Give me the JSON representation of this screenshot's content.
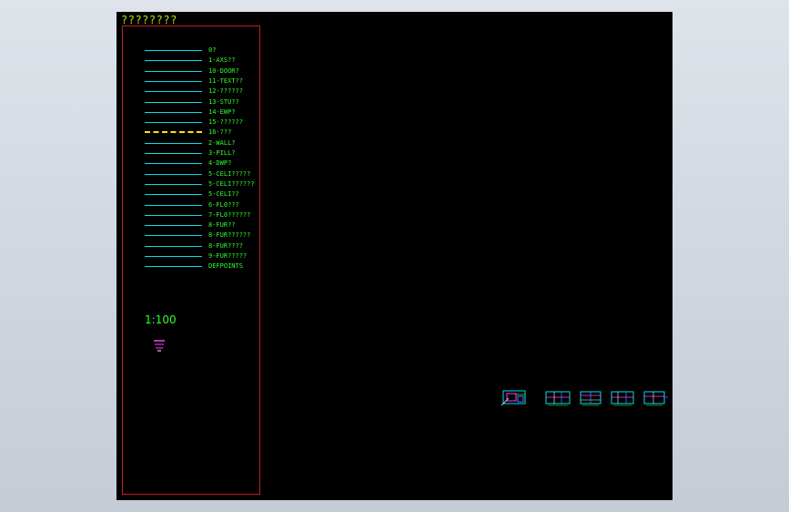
{
  "drawing": {
    "title": "????????",
    "scale": "1:100"
  },
  "legend": {
    "items": [
      {
        "label": "0?",
        "style": "solid"
      },
      {
        "label": "1-AXS??",
        "style": "solid"
      },
      {
        "label": "10-DOOR?",
        "style": "solid"
      },
      {
        "label": "11-TEXT??",
        "style": "solid"
      },
      {
        "label": "12-??????",
        "style": "solid"
      },
      {
        "label": "13-STU??",
        "style": "solid"
      },
      {
        "label": "14-EWP?",
        "style": "solid"
      },
      {
        "label": "15-??????",
        "style": "solid"
      },
      {
        "label": "16-???",
        "style": "dashed"
      },
      {
        "label": "2-WALL?",
        "style": "solid"
      },
      {
        "label": "3-PILL?",
        "style": "solid"
      },
      {
        "label": "4-DWP?",
        "style": "solid"
      },
      {
        "label": "5-CELI?????",
        "style": "solid"
      },
      {
        "label": "5-CELI??????",
        "style": "solid"
      },
      {
        "label": "5-CELI??",
        "style": "solid"
      },
      {
        "label": "6-FL0???",
        "style": "solid"
      },
      {
        "label": "7-FL0??????",
        "style": "solid"
      },
      {
        "label": "8-FUR??",
        "style": "solid"
      },
      {
        "label": "8-FUR??????",
        "style": "solid"
      },
      {
        "label": "8-FUR????",
        "style": "solid"
      },
      {
        "label": "9-FUR?????",
        "style": "solid"
      },
      {
        "label": "DEFPOINTS",
        "style": "solid"
      }
    ]
  },
  "colors": {
    "canvas": "#000000",
    "frame": "#c21d1d",
    "legend_line": "#00e0e8",
    "dashed_line": "#ffe600",
    "label_text": "#2cff2c",
    "title_text": "#b8e600"
  },
  "thumbnails": [
    "drawing-thumb-1",
    "drawing-thumb-2",
    "drawing-thumb-3",
    "drawing-thumb-4",
    "drawing-thumb-5"
  ]
}
